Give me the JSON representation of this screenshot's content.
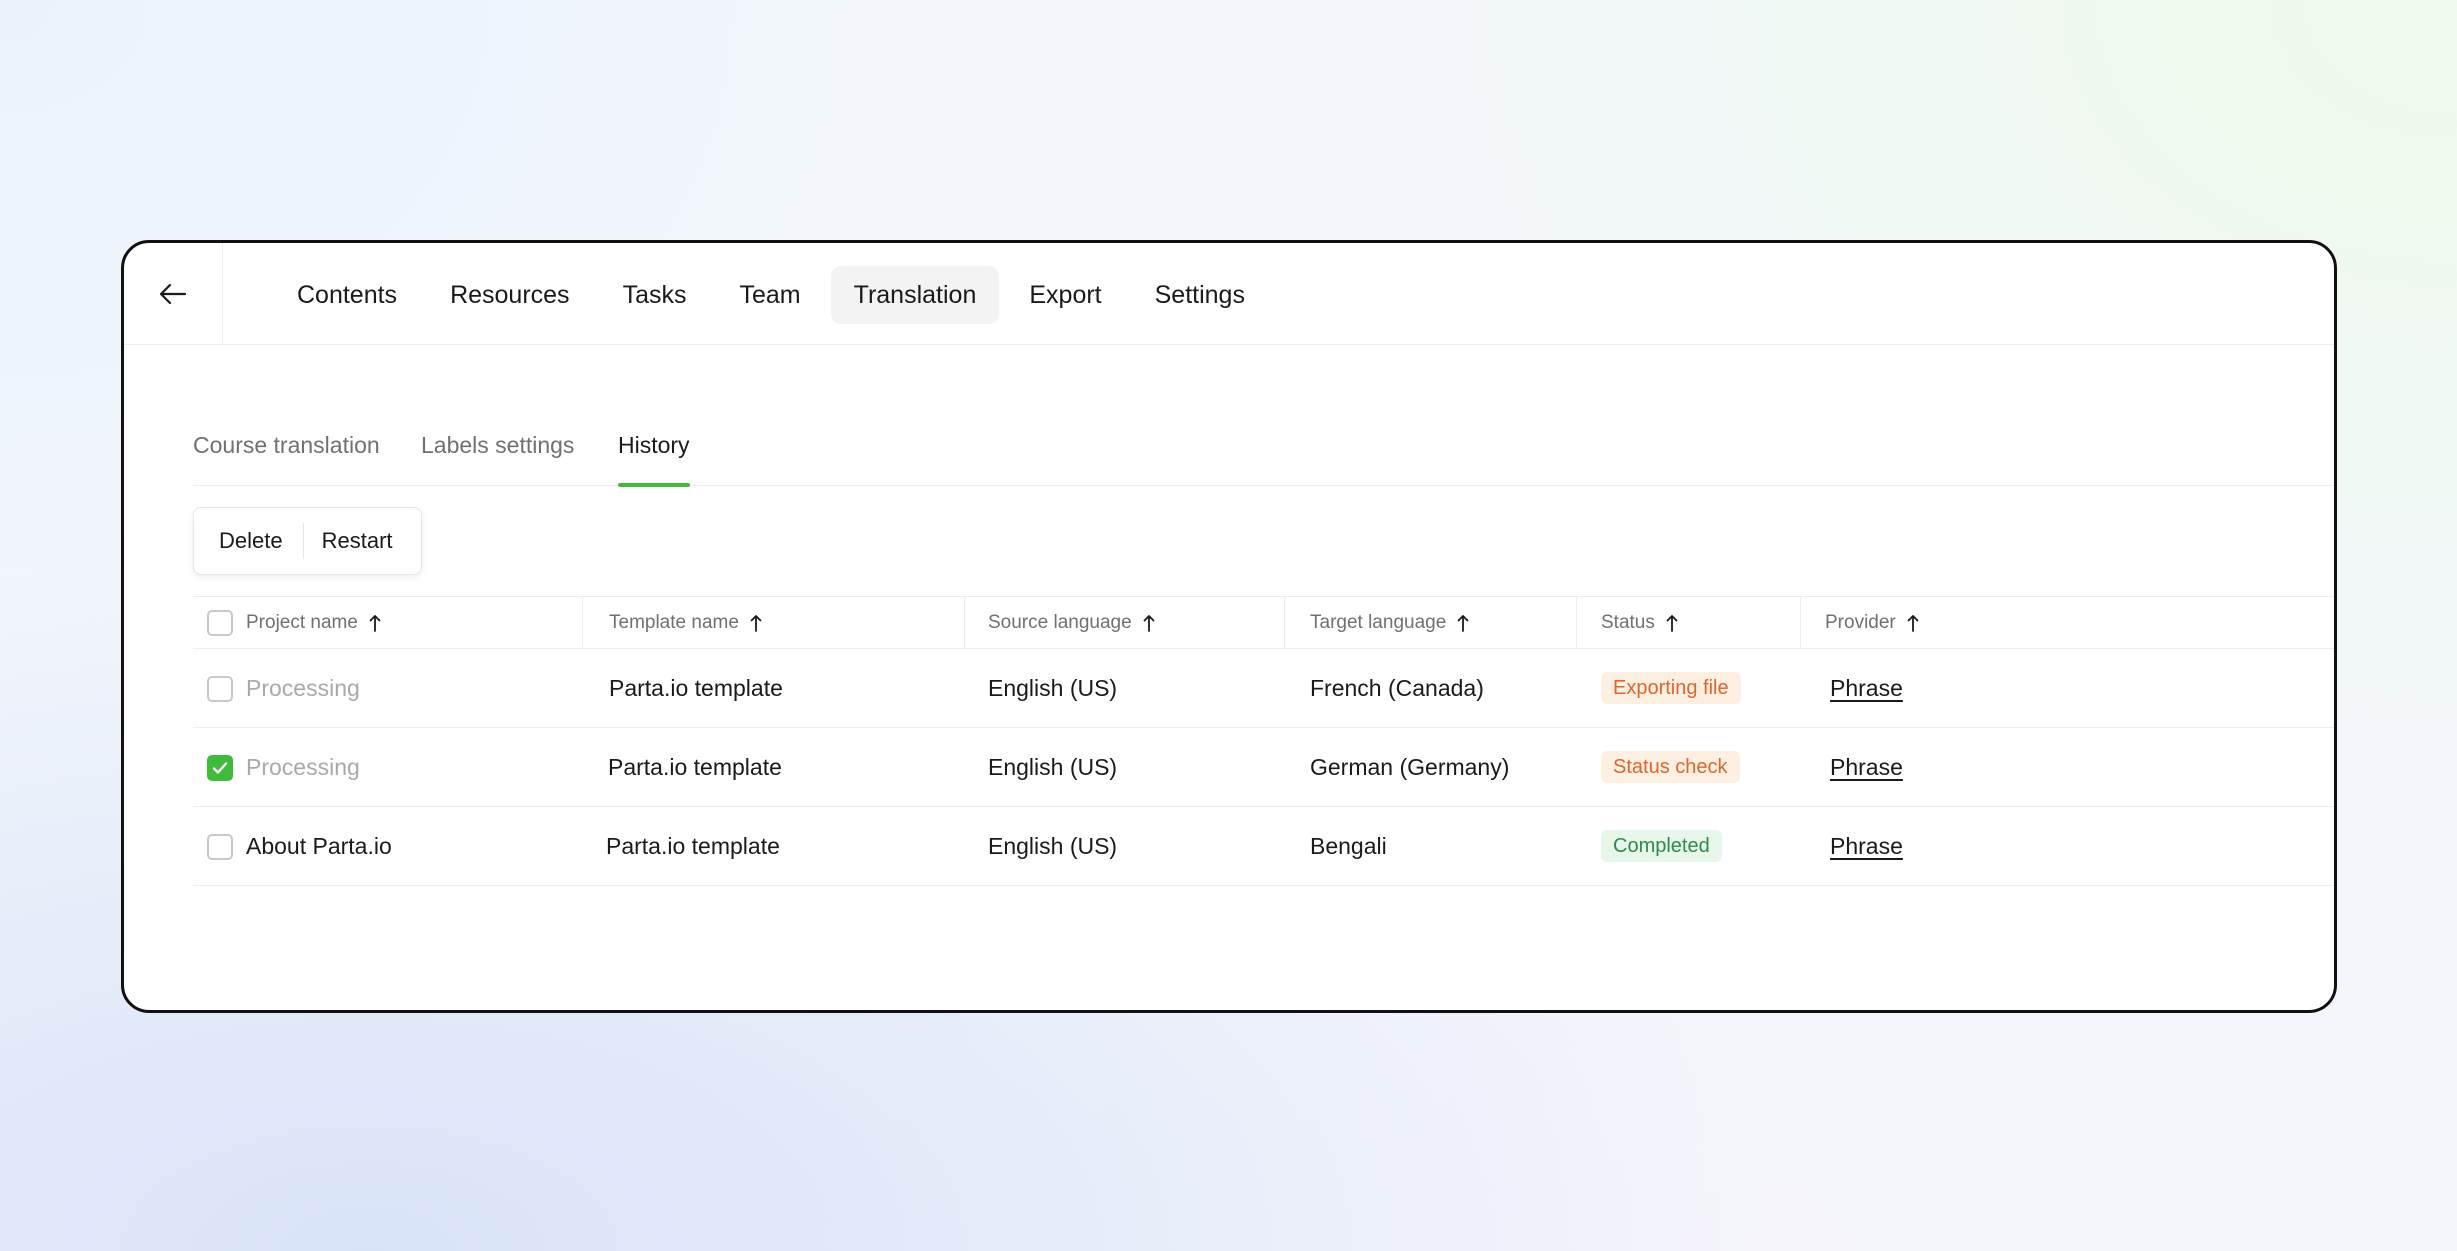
{
  "nav": {
    "items": [
      {
        "label": "Contents",
        "active": false
      },
      {
        "label": "Resources",
        "active": false
      },
      {
        "label": "Tasks",
        "active": false
      },
      {
        "label": "Team",
        "active": false
      },
      {
        "label": "Translation",
        "active": true
      },
      {
        "label": "Export",
        "active": false
      },
      {
        "label": "Settings",
        "active": false
      }
    ]
  },
  "subtabs": [
    {
      "label": "Course translation",
      "active": false
    },
    {
      "label": "Labels settings",
      "active": false
    },
    {
      "label": "History",
      "active": true
    }
  ],
  "actions": {
    "delete": "Delete",
    "restart": "Restart"
  },
  "table": {
    "columns": [
      "Project name",
      "Template name",
      "Source language",
      "Target language",
      "Status",
      "Provider"
    ],
    "rows": [
      {
        "checked": false,
        "project": "Processing",
        "project_muted": true,
        "template": "Parta.io template",
        "source": "English (US)",
        "target": "French (Canada)",
        "status": "Exporting file",
        "provider": "Phrase"
      },
      {
        "checked": true,
        "project": "Processing",
        "project_muted": true,
        "template": "Parta.io template",
        "source": "English (US)",
        "target": "German (Germany)",
        "status": "Status check",
        "provider": "Phrase"
      },
      {
        "checked": false,
        "project": "About Parta.io",
        "project_muted": false,
        "template": "Parta.io template",
        "source": "English (US)",
        "target": "Bengali",
        "status": "Completed",
        "provider": "Phrase"
      }
    ]
  },
  "colors": {
    "accent": "#3fba3a",
    "status_orange_text": "#e0652b",
    "status_orange_bg": "#fdf0e2",
    "status_green_text": "#2f8a4c",
    "status_green_bg": "#e7f5ea"
  }
}
